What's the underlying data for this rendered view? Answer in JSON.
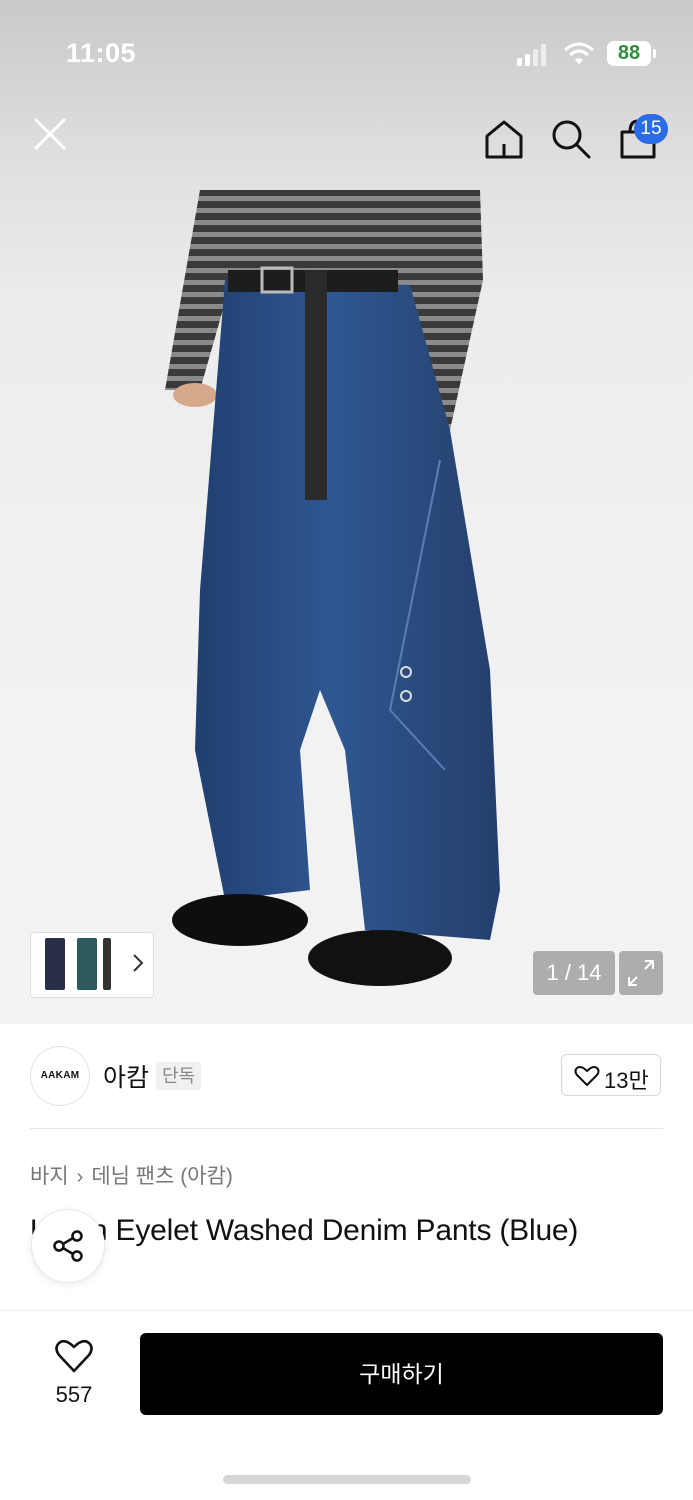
{
  "status_bar": {
    "time": "11:05",
    "battery": "88"
  },
  "header": {
    "icons": [
      "close-icon",
      "home-icon",
      "search-icon",
      "shopping-bag-icon"
    ],
    "cart_badge": "15"
  },
  "gallery": {
    "counter": "1 / 14",
    "thumbnail_strip_icon": "chevron-right-icon",
    "expand_icon": "expand-icon"
  },
  "brand": {
    "logo_text": "AAKAM",
    "name": "아캄",
    "tag": "단독",
    "likes": "13만"
  },
  "breadcrumb": [
    "바지",
    "데님 팬츠 (아캄)"
  ],
  "product": {
    "title": "Union Eyelet Washed Denim Pants (Blue)"
  },
  "bottom_bar": {
    "wish_count": "557",
    "buy_label": "구매하기"
  },
  "colors": {
    "badge": "#2b6be6",
    "buy_button": "#000000",
    "denim": "#2c4f86"
  }
}
